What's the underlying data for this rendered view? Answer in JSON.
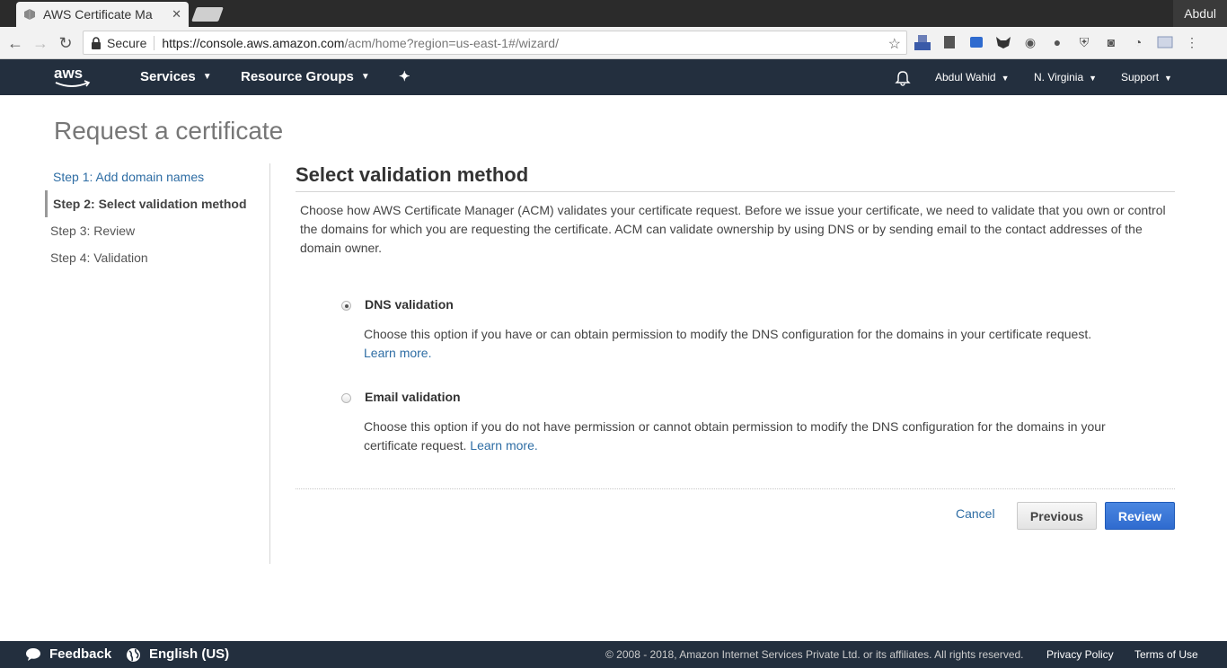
{
  "browser": {
    "tab_title": "AWS Certificate Ma",
    "profile_name": "Abdul",
    "secure_label": "Secure",
    "url_base": "https://console.aws.amazon.com",
    "url_path": "/acm/home?region=us-east-1#/wizard/"
  },
  "aws_nav": {
    "services": "Services",
    "resource_groups": "Resource Groups",
    "user": "Abdul Wahid",
    "region": "N. Virginia",
    "support": "Support"
  },
  "page": {
    "title": "Request a certificate",
    "steps": [
      {
        "label": "Step 1: Add domain names",
        "state": "link"
      },
      {
        "label": "Step 2: Select validation method",
        "state": "active"
      },
      {
        "label": "Step 3: Review",
        "state": "pending"
      },
      {
        "label": "Step 4: Validation",
        "state": "pending"
      }
    ],
    "section_title": "Select validation method",
    "intro": "Choose how AWS Certificate Manager (ACM) validates your certificate request. Before we issue your certificate, we need to validate that you own or control the domains for which you are requesting the certificate. ACM can validate ownership by using DNS or by sending email to the contact addresses of the domain owner.",
    "options": [
      {
        "label": "DNS validation",
        "selected": true,
        "description": "Choose this option if you have or can obtain permission to modify the DNS configuration for the domains in your certificate request.",
        "learn_more": "Learn more."
      },
      {
        "label": "Email validation",
        "selected": false,
        "description": "Choose this option if you do not have permission or cannot obtain permission to modify the DNS configuration for the domains in your certificate request.",
        "learn_more": "Learn more."
      }
    ],
    "cancel": "Cancel",
    "previous": "Previous",
    "review": "Review"
  },
  "footer": {
    "feedback": "Feedback",
    "language": "English (US)",
    "copyright": "© 2008 - 2018, Amazon Internet Services Private Ltd. or its affiliates. All rights reserved.",
    "privacy": "Privacy Policy",
    "terms": "Terms of Use"
  },
  "colors": {
    "aws_nav_bg": "#232f3e",
    "link": "#2e6da4",
    "primary_button": "#2f6bcf"
  }
}
